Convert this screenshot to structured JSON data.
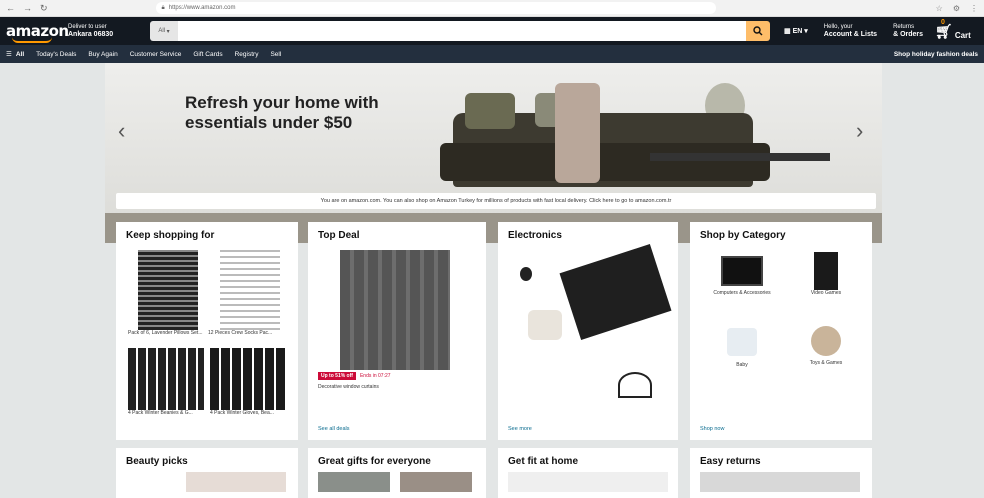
{
  "browser": {
    "url": "https://www.amazon.com"
  },
  "header": {
    "logo": "amazon",
    "deliver_line1": "Deliver to user",
    "deliver_line2": "Ankara 06830",
    "search_category": "All",
    "search_placeholder": "",
    "lang": "EN",
    "account_line1": "Hello, your",
    "account_line2": "Account & Lists",
    "orders_line1": "Returns",
    "orders_line2": "& Orders",
    "cart_label": "Cart",
    "cart_count": "0"
  },
  "subnav": {
    "items": [
      "All",
      "Today's Deals",
      "Buy Again",
      "Customer Service",
      "Gift Cards",
      "Registry",
      "Sell"
    ],
    "promo": "Shop holiday fashion deals"
  },
  "hero": {
    "headline": "Refresh your home with essentials under $50"
  },
  "notice": "You are on amazon.com. You can also shop on Amazon Turkey for millions of products with fast local delivery. Click here to go to amazon.com.tr",
  "cards": [
    {
      "title": "Keep shopping for",
      "items": [
        "Pack of 6, Lavender Pillows Set...",
        "12 Pieces Crew Socks Pac...",
        "4 Pack Winter Beanies & G...",
        "4 Pack Winter Gloves, Bea..."
      ],
      "link": ""
    },
    {
      "title": "Top Deal",
      "badge": "Up to 51% off",
      "badge_note": "Ends in 07:27",
      "caption": "Decorative window curtains",
      "link": "See all deals"
    },
    {
      "title": "Electronics",
      "link": "See more"
    },
    {
      "title": "Shop by Category",
      "items": [
        "Computers & Accessories",
        "Video Games",
        "Baby",
        "Toys & Games"
      ],
      "link": "Shop now"
    }
  ],
  "bottom_cards": [
    "Beauty picks",
    "Great gifts for everyone",
    "Get fit at home",
    "Easy returns"
  ],
  "colors": {
    "topbar": "#131921",
    "subnav": "#232f3e",
    "accent": "#febd69",
    "smile": "#ff9900"
  }
}
